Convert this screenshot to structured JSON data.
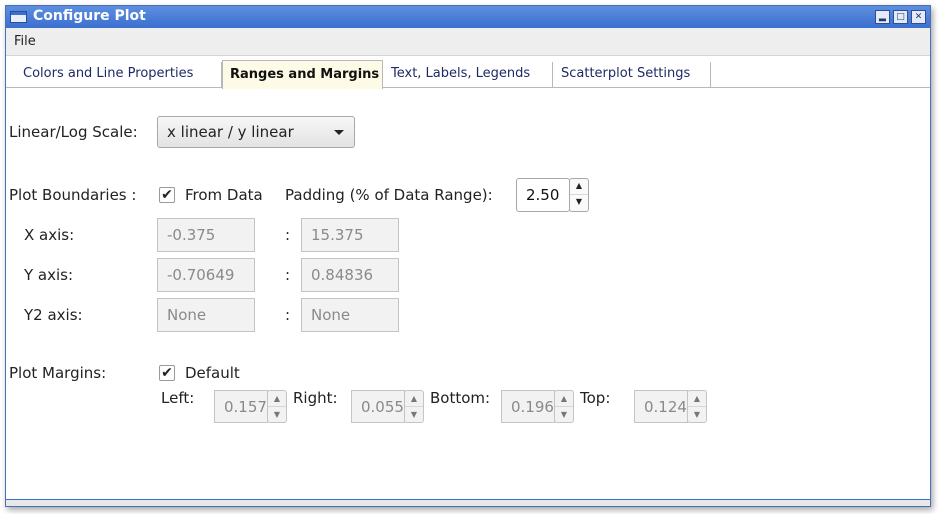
{
  "window": {
    "title": "Configure Plot"
  },
  "menu": {
    "file_label": "File"
  },
  "tabs": [
    {
      "label": "Colors and Line Properties",
      "active": false
    },
    {
      "label": "Ranges and Margins",
      "active": true
    },
    {
      "label": "Text, Labels, Legends",
      "active": false
    },
    {
      "label": "Scatterplot Settings",
      "active": false
    }
  ],
  "scale": {
    "label": "Linear/Log Scale:",
    "selected": "x linear / y linear"
  },
  "boundaries": {
    "label": "Plot Boundaries :",
    "from_data_label": "From Data",
    "from_data_checked": true,
    "padding_label": "Padding (% of Data Range):",
    "padding_value": "2.50",
    "colon": ":",
    "axes": [
      {
        "label": "X axis:",
        "min": "-0.375",
        "max": "15.375"
      },
      {
        "label": "Y axis:",
        "min": "-0.70649",
        "max": "0.84836"
      },
      {
        "label": "Y2 axis:",
        "min": "None",
        "max": "None"
      }
    ]
  },
  "margins": {
    "label": "Plot Margins:",
    "default_label": "Default",
    "default_checked": true,
    "left_label": "Left:",
    "left_value": "0.157",
    "right_label": "Right:",
    "right_value": "0.055",
    "bottom_label": "Bottom:",
    "bottom_value": "0.196",
    "top_label": "Top:",
    "top_value": "0.124"
  },
  "icons": {
    "check": "✔",
    "spin_up": "▲",
    "spin_down": "▼",
    "minimize": "▂",
    "maximize": "□",
    "close": "✕"
  }
}
